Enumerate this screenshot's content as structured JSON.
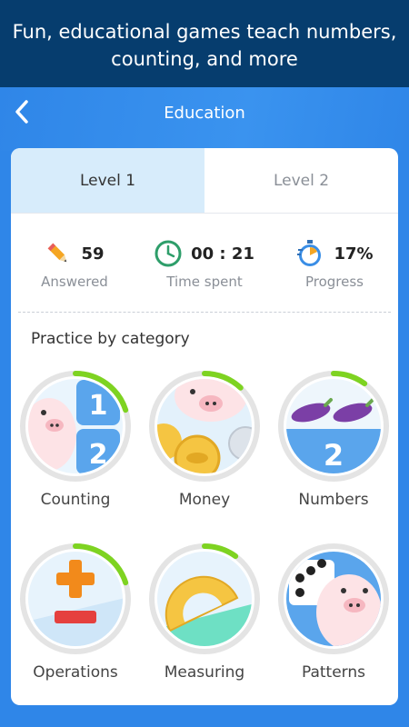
{
  "banner": {
    "line1": "Fun, educational games teach numbers,",
    "line2": "counting, and more"
  },
  "header": {
    "title": "Education"
  },
  "tabs": [
    {
      "label": "Level 1",
      "active": true
    },
    {
      "label": "Level 2",
      "active": false
    }
  ],
  "stats": [
    {
      "value": "59",
      "label": "Answered",
      "icon": "pencil-icon"
    },
    {
      "value": "00 : 21",
      "label": "Time spent",
      "icon": "clock-icon"
    },
    {
      "value": "17%",
      "label": "Progress",
      "icon": "stopwatch-icon"
    }
  ],
  "section": {
    "title": "Practice by category"
  },
  "categories": [
    {
      "label": "Counting",
      "progress": 0.2
    },
    {
      "label": "Money",
      "progress": 0.12
    },
    {
      "label": "Numbers",
      "progress": 0.1
    },
    {
      "label": "Operations",
      "progress": 0.2
    },
    {
      "label": "Measuring",
      "progress": 0.1
    },
    {
      "label": "Patterns",
      "progress": 0.0
    }
  ],
  "colors": {
    "accent": "#2f86e8",
    "banner": "#063d6e",
    "progress": "#7ed321",
    "tab_active": "#d7ecfb"
  }
}
